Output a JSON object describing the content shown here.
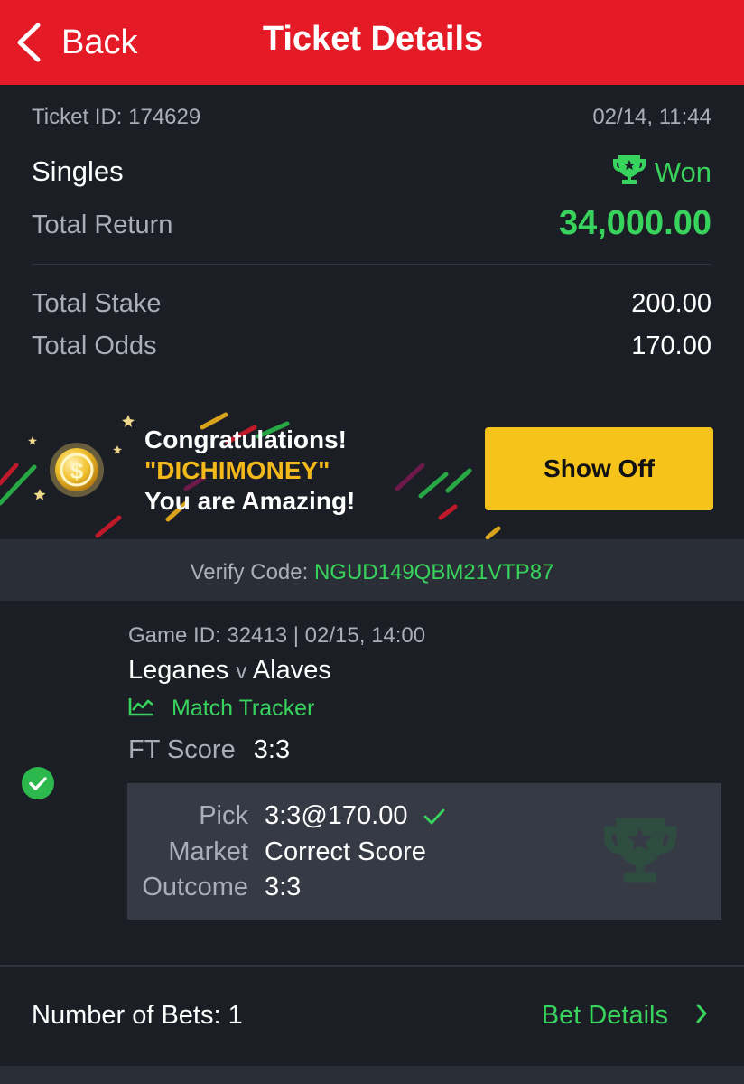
{
  "header": {
    "back_label": "Back",
    "title": "Ticket Details"
  },
  "ticket": {
    "id_text": "Ticket ID: 174629",
    "datetime": "02/14, 11:44",
    "bet_type": "Singles",
    "status": "Won",
    "total_return_label": "Total Return",
    "total_return": "34,000.00",
    "total_stake_label": "Total Stake",
    "total_stake": "200.00",
    "total_odds_label": "Total Odds",
    "total_odds": "170.00"
  },
  "banner": {
    "line1": "Congratulations!",
    "line2": "\"DICHIMONEY\"",
    "line3": "You are Amazing!",
    "button_label": "Show Off"
  },
  "verify": {
    "label": "Verify Code:",
    "code": "NGUD149QBM21VTP87"
  },
  "game": {
    "meta": "Game ID: 32413 | 02/15, 14:00",
    "home": "Leganes",
    "vs": "v",
    "away": "Alaves",
    "tracker_label": "Match Tracker",
    "ft_label": "FT Score",
    "ft_value": "3:3",
    "pick_label": "Pick",
    "pick_value": "3:3@170.00",
    "market_label": "Market",
    "market_value": "Correct Score",
    "outcome_label": "Outcome",
    "outcome_value": "3:3"
  },
  "footer": {
    "bets_count": "Number of Bets: 1",
    "bet_details_label": "Bet Details"
  },
  "colors": {
    "header_red": "#e41b26",
    "accent_green": "#38d35c",
    "button_yellow": "#f6c31a",
    "background": "#1b1e24"
  },
  "icons": [
    "chevron-left-icon",
    "trophy-icon",
    "coin-icon",
    "chart-icon",
    "check-circle-icon",
    "check-icon",
    "chevron-right-icon"
  ]
}
